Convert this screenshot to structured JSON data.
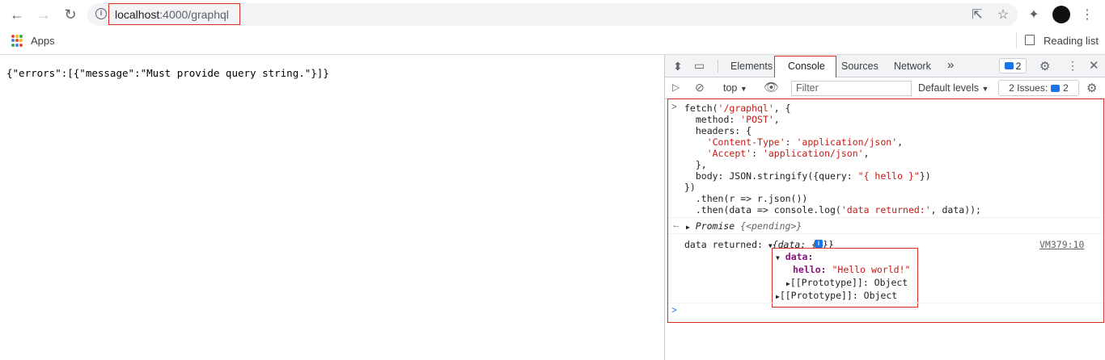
{
  "browser": {
    "url_host": "localhost",
    "url_path": ":4000/graphql",
    "bookmarks": {
      "apps_label": "Apps",
      "reading_list_label": "Reading list"
    }
  },
  "page": {
    "content": "{\"errors\":[{\"message\":\"Must provide query string.\"}]}"
  },
  "devtools": {
    "tabs": [
      {
        "label": "Elements"
      },
      {
        "label": "Console",
        "active": true
      },
      {
        "label": "Sources"
      },
      {
        "label": "Network"
      }
    ],
    "more_tabs": "»",
    "issue_count": "2",
    "context": "top",
    "filter_placeholder": "Filter",
    "levels_label": "Default levels",
    "issues_label": "2 Issues:",
    "issues_count": "2",
    "console": {
      "input_lines": [
        "fetch('/graphql', {",
        "  method: 'POST',",
        "  headers: {",
        "    'Content-Type': 'application/json',",
        "    'Accept': 'application/json',",
        "  },",
        "  body: JSON.stringify({query: \"{ hello }\"})",
        "})",
        "  .then(r => r.json())",
        "  .then(data => console.log('data returned:', data));"
      ],
      "promise_label": "Promise",
      "promise_state": "{<pending>}",
      "log_prefix": "data returned:",
      "log_obj_preview": "{data: {…}}",
      "source_link": "VM379:10",
      "obj_data_key": "data:",
      "obj_hello_key": "hello:",
      "obj_hello_value": "\"Hello world!\"",
      "obj_proto_inner": "[[Prototype]]: Object",
      "obj_proto_outer": "[[Prototype]]: Object"
    }
  },
  "colors": {
    "highlight": "#d93025",
    "string": "#c41a16",
    "key": "#881280",
    "accent": "#1a73e8"
  }
}
